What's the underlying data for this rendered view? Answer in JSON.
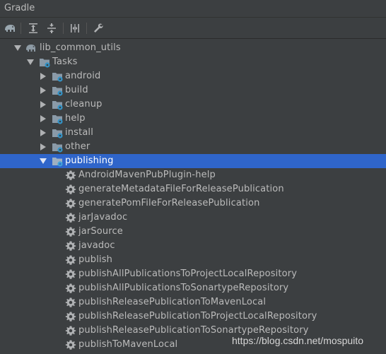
{
  "panel": {
    "title": "Gradle"
  },
  "toolbar": {
    "buttons": [
      {
        "icon": "elephant-icon"
      },
      {
        "icon": "expand-all-icon"
      },
      {
        "icon": "collapse-all-icon"
      },
      {
        "icon": "toggle-offline-icon"
      },
      {
        "icon": "wrench-icon"
      }
    ]
  },
  "tree": {
    "project": "lib_common_utils",
    "tasks_label": "Tasks",
    "groups": [
      "android",
      "build",
      "cleanup",
      "help",
      "install",
      "other",
      "publishing"
    ],
    "selected_group": "publishing",
    "publishing_tasks": [
      "AndroidMavenPubPlugin-help",
      "generateMetadataFileForReleasePublication",
      "generatePomFileForReleasePublication",
      "jarJavadoc",
      "jarSource",
      "javadoc",
      "publish",
      "publishAllPublicationsToProjectLocalRepository",
      "publishAllPublicationsToSonartypeRepository",
      "publishReleasePublicationToMavenLocal",
      "publishReleasePublicationToProjectLocalRepository",
      "publishReleasePublicationToSonartypeRepository",
      "publishToMavenLocal"
    ]
  },
  "watermark": "https://blog.csdn.net/mospuito",
  "colors": {
    "background": "#3c3f41",
    "selection": "#2f65ca",
    "text": "#bbbbbb",
    "folder": "#8a9aa8",
    "gear_badge": "#3592c4"
  }
}
